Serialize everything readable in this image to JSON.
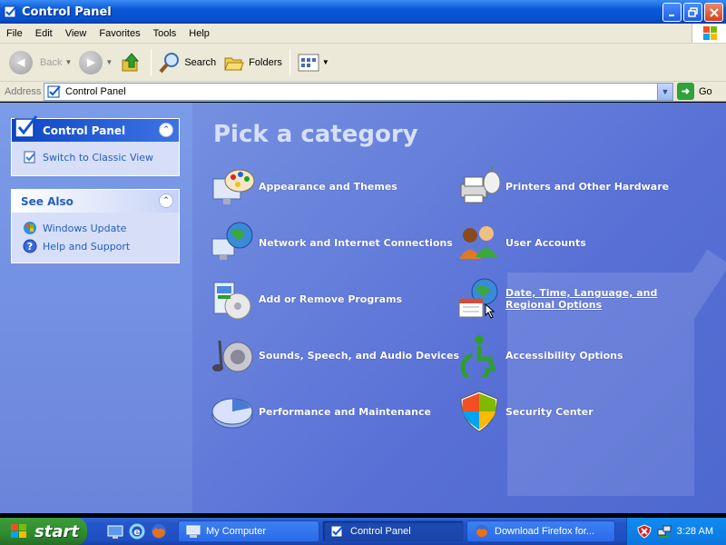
{
  "window": {
    "title": "Control Panel"
  },
  "menu": [
    "File",
    "Edit",
    "View",
    "Favorites",
    "Tools",
    "Help"
  ],
  "toolbar": {
    "back": "Back",
    "search": "Search",
    "folders": "Folders"
  },
  "address": {
    "label": "Address",
    "value": "Control Panel",
    "go": "Go"
  },
  "left_panel": {
    "control_panel": {
      "title": "Control Panel",
      "items": [
        {
          "label": "Switch to Classic View",
          "icon": "switch-view-icon"
        }
      ]
    },
    "see_also": {
      "title": "See Also",
      "items": [
        {
          "label": "Windows Update",
          "icon": "windows-update-icon"
        },
        {
          "label": "Help and Support",
          "icon": "help-icon"
        }
      ]
    }
  },
  "main": {
    "heading": "Pick a category",
    "categories": [
      {
        "label": "Appearance and Themes",
        "icon": "appearance-icon"
      },
      {
        "label": "Printers and Other Hardware",
        "icon": "printer-icon"
      },
      {
        "label": "Network and Internet Connections",
        "icon": "network-icon"
      },
      {
        "label": "User Accounts",
        "icon": "user-accounts-icon"
      },
      {
        "label": "Add or Remove Programs",
        "icon": "add-remove-icon"
      },
      {
        "label": "Date, Time, Language, and Regional Options",
        "icon": "date-time-icon"
      },
      {
        "label": "Sounds, Speech, and Audio Devices",
        "icon": "sounds-icon"
      },
      {
        "label": "Accessibility Options",
        "icon": "accessibility-icon"
      },
      {
        "label": "Performance and Maintenance",
        "icon": "performance-icon"
      },
      {
        "label": "Security Center",
        "icon": "security-icon"
      }
    ]
  },
  "taskbar": {
    "start": "start",
    "tasks": [
      {
        "label": "My Computer"
      },
      {
        "label": "Control Panel"
      },
      {
        "label": "Download Firefox for..."
      }
    ],
    "clock": "3:28 AM"
  },
  "colors": {
    "accent": "#215dc6",
    "title_bar": "#0a58d8",
    "main_bg": "#5870d6",
    "taskbar": "#245edb",
    "start": "#3c9e3c"
  }
}
